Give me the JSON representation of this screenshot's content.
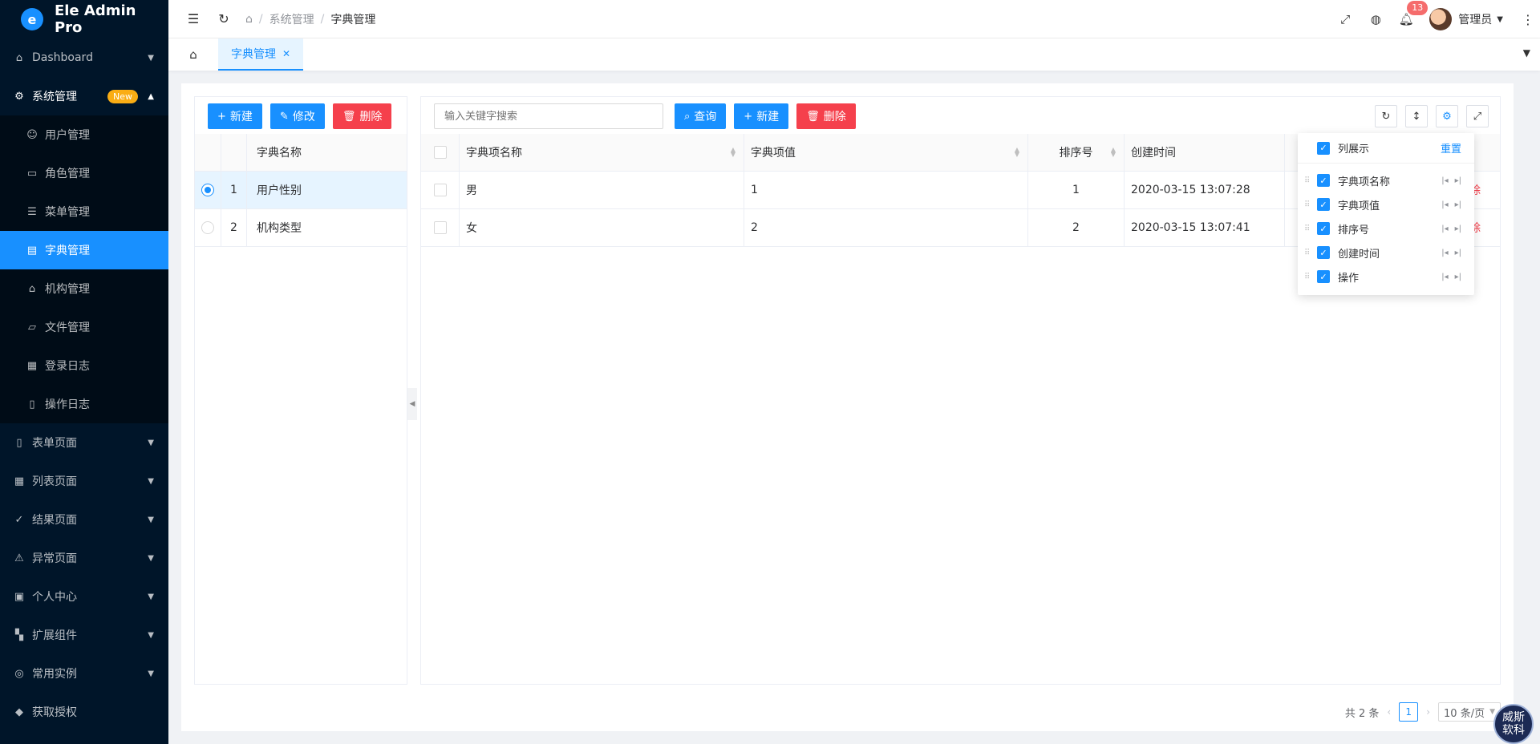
{
  "app": {
    "title": "Ele Admin Pro"
  },
  "sidebar": {
    "items": [
      {
        "label": "Dashboard"
      },
      {
        "label": "系统管理",
        "badge": "New"
      },
      {
        "label": "表单页面"
      },
      {
        "label": "列表页面"
      },
      {
        "label": "结果页面"
      },
      {
        "label": "异常页面"
      },
      {
        "label": "个人中心"
      },
      {
        "label": "扩展组件"
      },
      {
        "label": "常用实例"
      },
      {
        "label": "获取授权"
      }
    ],
    "sub_items": [
      {
        "label": "用户管理"
      },
      {
        "label": "角色管理"
      },
      {
        "label": "菜单管理"
      },
      {
        "label": "字典管理"
      },
      {
        "label": "机构管理"
      },
      {
        "label": "文件管理"
      },
      {
        "label": "登录日志"
      },
      {
        "label": "操作日志"
      }
    ]
  },
  "header": {
    "breadcrumb": [
      "系统管理",
      "字典管理"
    ],
    "notice_count": "13",
    "user_name": "管理员"
  },
  "tabs": [
    {
      "label": "字典管理"
    }
  ],
  "left": {
    "buttons": {
      "add": "新建",
      "edit": "修改",
      "delete": "删除"
    },
    "column_header": "字典名称",
    "rows": [
      {
        "index": "1",
        "name": "用户性别",
        "selected": true
      },
      {
        "index": "2",
        "name": "机构类型",
        "selected": false
      }
    ]
  },
  "right": {
    "search_placeholder": "输入关键字搜索",
    "buttons": {
      "query": "查询",
      "add": "新建",
      "delete": "删除"
    },
    "columns": [
      "字典项名称",
      "字典项值",
      "排序号",
      "创建时间"
    ],
    "rows": [
      {
        "name": "男",
        "value": "1",
        "sort": "1",
        "created": "2020-03-15 13:07:28",
        "op": "删除"
      },
      {
        "name": "女",
        "value": "2",
        "sort": "2",
        "created": "2020-03-15 13:07:41",
        "op": "删除"
      }
    ],
    "pagination": {
      "total": "共 2 条",
      "page": "1",
      "page_size": "10 条/页"
    }
  },
  "column_settings": {
    "title": "列展示",
    "reset": "重置",
    "items": [
      "字典项名称",
      "字典项值",
      "排序号",
      "创建时间",
      "操作"
    ]
  },
  "watermark": {
    "line1": "威斯",
    "line2": "软科"
  }
}
